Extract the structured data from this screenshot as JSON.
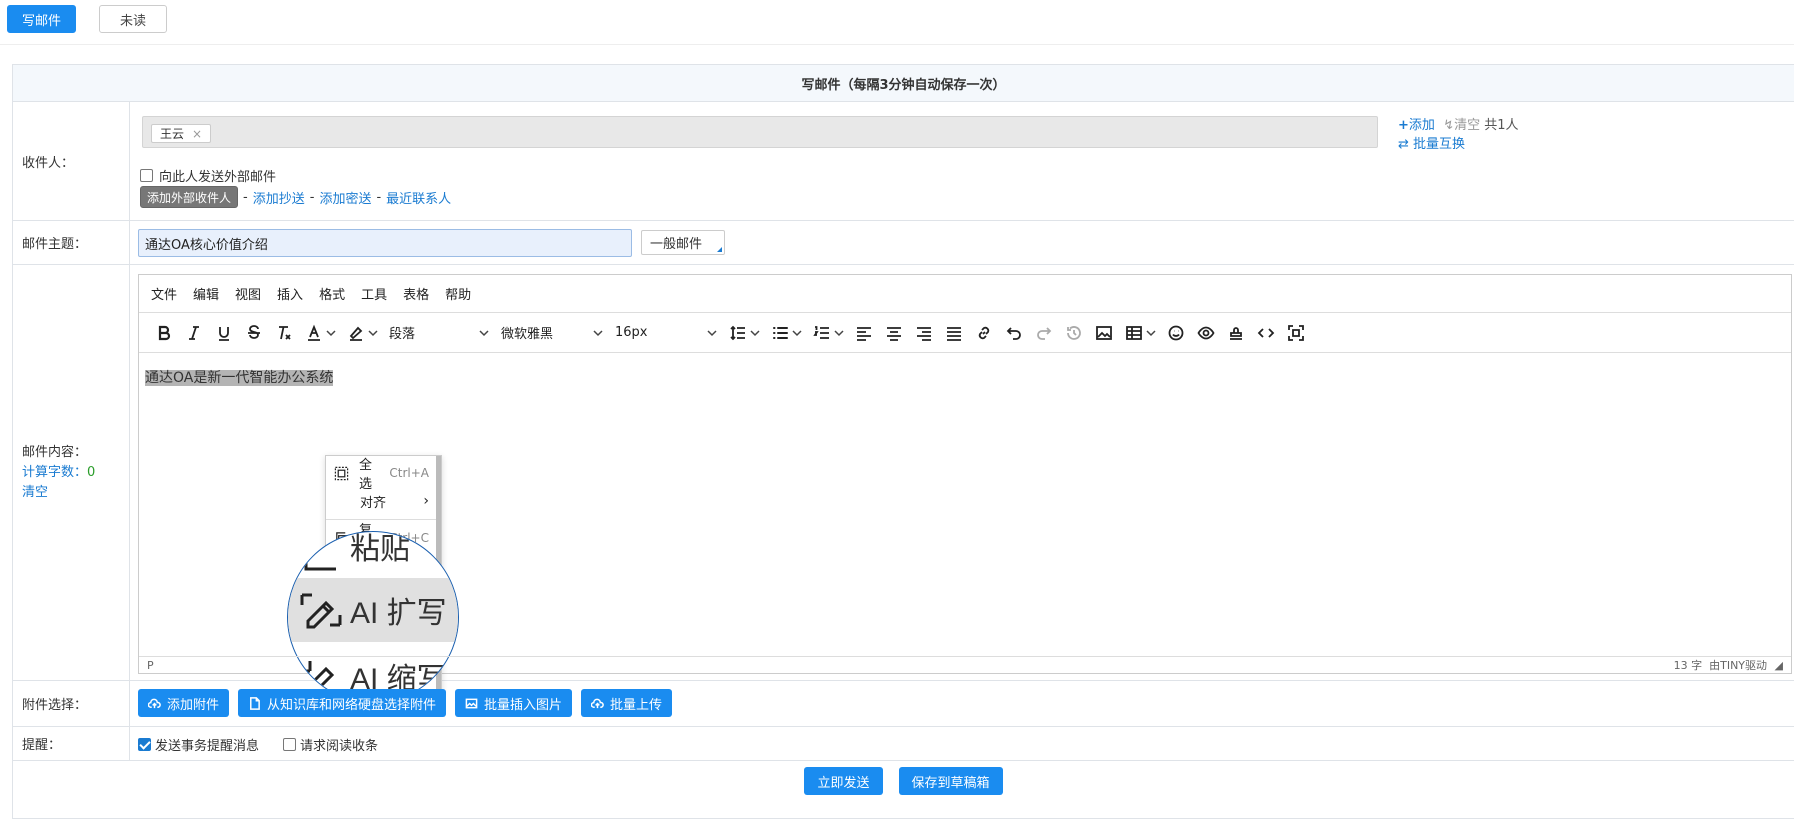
{
  "top_tabs": {
    "compose": "写邮件",
    "unread": "未读"
  },
  "form": {
    "title": "写邮件（每隔3分钟自动保存一次）",
    "recipient": {
      "label": "收件人：",
      "tags": [
        "王云"
      ],
      "add": "添加",
      "clear": "清空",
      "count": "共1人",
      "batch_swap": "批量互换",
      "external_check": "向此人发送外部邮件",
      "add_external": "添加外部收件人",
      "cc": "添加抄送",
      "bcc": "添加密送",
      "recent": "最近联系人",
      "sep": "-"
    },
    "subject": {
      "label": "邮件主题：",
      "value": "通达OA核心价值介绍",
      "type": "一般邮件"
    },
    "body": {
      "label": "邮件内容：",
      "word_count_label": "计算字数：",
      "word_count": "0",
      "clear": "清空",
      "menubar": [
        "文件",
        "编辑",
        "视图",
        "插入",
        "格式",
        "工具",
        "表格",
        "帮助"
      ],
      "block_format": "段落",
      "font_family": "微软雅黑",
      "font_size": "16px",
      "content": "通达OA是新一代智能办公系统",
      "status_path": "P",
      "status_words": "13 字",
      "status_powered": "由TINY驱动",
      "context_menu": [
        {
          "label": "全选",
          "shortcut": "Ctrl+A",
          "icon": "select-all-icon"
        },
        {
          "label": "对齐",
          "shortcut": "",
          "icon": "align-icon"
        },
        {
          "label": "复制",
          "shortcut": "Ctrl+C",
          "icon": "copy-icon"
        }
      ],
      "magnifier": {
        "paste": "粘贴",
        "ai_expand": "AI 扩写",
        "ai_shrink": "AI 缩写"
      }
    },
    "attachment": {
      "label": "附件选择：",
      "add": "添加附件",
      "from_kb": "从知识库和网络硬盘选择附件",
      "batch_image": "批量插入图片",
      "batch_upload": "批量上传"
    },
    "remind": {
      "label": "提醒：",
      "send_notice": "发送事务提醒消息",
      "read_receipt": "请求阅读收条"
    },
    "actions": {
      "send": "立即发送",
      "save_draft": "保存到草稿箱"
    }
  },
  "colors": {
    "primary": "#1a8cf0",
    "link": "#1a7bd1",
    "green": "#2a9d2a"
  }
}
